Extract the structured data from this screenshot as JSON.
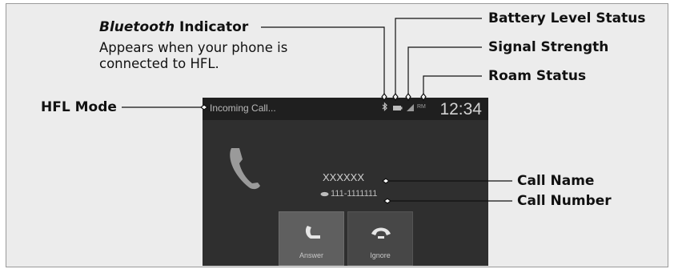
{
  "callouts": {
    "bluetooth_title_italic": "Bluetooth",
    "bluetooth_title_rest": " Indicator",
    "bluetooth_desc": "Appears when your phone is connected to HFL.",
    "hfl_mode": "HFL Mode",
    "battery_level": "Battery Level Status",
    "signal_strength": "Signal Strength",
    "roam_status": "Roam Status",
    "call_name": "Call Name",
    "call_number": "Call Number"
  },
  "screen": {
    "status_text": "Incoming Call...",
    "roam_indicator": "RM",
    "clock": "12:34",
    "call_name": "XXXXXX",
    "call_number": "111-1111111",
    "answer_label": "Answer",
    "ignore_label": "Ignore"
  },
  "icons": [
    "bluetooth-icon",
    "battery-icon",
    "signal-icon",
    "phone-handset-icon",
    "answer-icon",
    "hang-up-icon"
  ]
}
